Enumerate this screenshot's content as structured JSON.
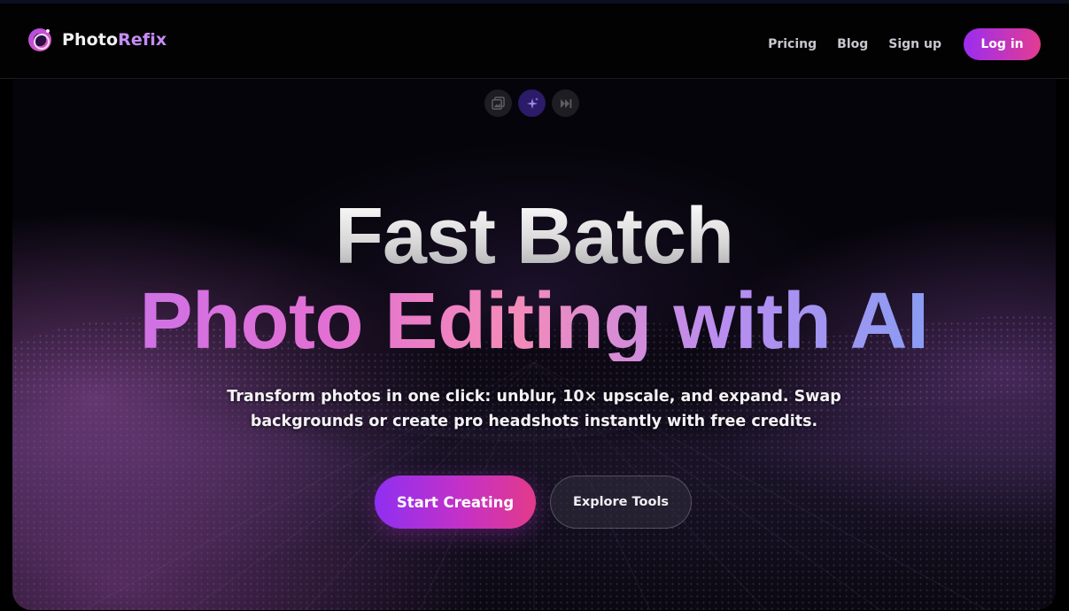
{
  "brand": {
    "name_part1": "Photo",
    "name_part2": "Refix",
    "icon": "camera-lens-icon"
  },
  "nav": {
    "links": [
      {
        "label": "Pricing"
      },
      {
        "label": "Blog"
      },
      {
        "label": "Sign up"
      }
    ],
    "login_label": "Log in"
  },
  "mode_switch": {
    "icons": [
      "gallery-icon",
      "sparkles-icon",
      "fast-forward-icon"
    ],
    "active_index": 1
  },
  "hero": {
    "headline_line1": "Fast Batch",
    "headline_line2": "Photo Editing with AI",
    "subtitle": "Transform photos in one click: unblur, 10× upscale, and expand. Swap backgrounds or create pro headshots instantly with free credits.",
    "primary_cta": "Start Creating",
    "secondary_cta": "Explore Tools"
  },
  "colors": {
    "accent_purple": "#9a2df0",
    "accent_pink": "#e43c90",
    "brand_accent": "#c58cf6",
    "headline_gradient": [
      "#c274f0",
      "#e26fd4",
      "#f48bb8",
      "#b98df0",
      "#6ca6f4"
    ]
  }
}
